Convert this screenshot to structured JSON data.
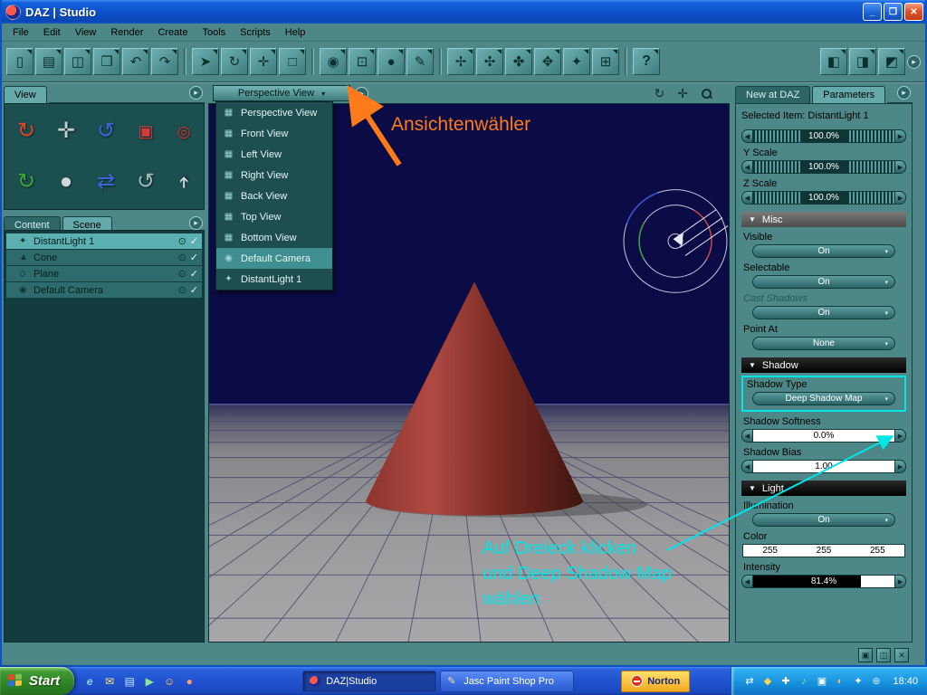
{
  "colors": {
    "accent_teal": "#4e8788",
    "panel_dark_teal": "#123c3d",
    "titlebar_blue": "#0d51c8",
    "taskbar_blue": "#2152cf",
    "annotation_orange": "#ff7a1a",
    "annotation_cyan": "#00e5e6",
    "highlight_box_cyan": "#00e5e6",
    "viewport_sky": "#0b0b46",
    "cone_red": "#a84038"
  },
  "glyphs": {
    "minimize": "_",
    "maximize": "❐",
    "close": "✕",
    "left_arrow": "◀",
    "right_arrow": "▶",
    "down_tri": "▾",
    "section_tri": "▼",
    "panel_arrow": "▸",
    "eye": "⊙",
    "check": "✓"
  },
  "titlebar": {
    "title": "DAZ | Studio"
  },
  "menubar": {
    "items": [
      "File",
      "Edit",
      "View",
      "Render",
      "Create",
      "Tools",
      "Scripts",
      "Help"
    ]
  },
  "toolbar": {
    "buttons": [
      {
        "name": "new-document",
        "glyph": "▯"
      },
      {
        "name": "open-file",
        "glyph": "▤"
      },
      {
        "name": "save-file",
        "glyph": "◫"
      },
      {
        "name": "copy",
        "glyph": "❐"
      },
      {
        "name": "undo",
        "glyph": "↶"
      },
      {
        "name": "redo",
        "glyph": "↷"
      },
      {
        "name": "select-tool",
        "glyph": "➤"
      },
      {
        "name": "rotate-tool",
        "glyph": "↻"
      },
      {
        "name": "translate-tool",
        "glyph": "✛"
      },
      {
        "name": "scale-tool",
        "glyph": "□"
      },
      {
        "name": "render",
        "glyph": "◉"
      },
      {
        "name": "spot-render",
        "glyph": "⊡"
      },
      {
        "name": "new-primitive",
        "glyph": "●"
      },
      {
        "name": "surface-selection",
        "glyph": "✎"
      },
      {
        "name": "create-null",
        "glyph": "✢"
      },
      {
        "name": "create-camera",
        "glyph": "✣"
      },
      {
        "name": "create-spotlight",
        "glyph": "✤"
      },
      {
        "name": "create-distant-light",
        "glyph": "✥"
      },
      {
        "name": "create-point-light",
        "glyph": "✦"
      },
      {
        "name": "frame-selection",
        "glyph": "⊞"
      },
      {
        "name": "help",
        "glyph": "?"
      }
    ],
    "right_buttons": [
      {
        "name": "layout-pane-left",
        "glyph": "◧"
      },
      {
        "name": "layout-pane-right",
        "glyph": "◨"
      },
      {
        "name": "layout-pane-split",
        "glyph": "◩"
      },
      {
        "name": "panel-expand",
        "glyph": "▸"
      }
    ]
  },
  "view_panel": {
    "tab": "View",
    "tools": [
      {
        "name": "orbit-camera",
        "glyph": "↻"
      },
      {
        "name": "pan-camera",
        "glyph": "✛"
      },
      {
        "name": "bank-camera",
        "glyph": "↺"
      },
      {
        "name": "frame-view",
        "glyph": "▣"
      },
      {
        "name": "aim-camera",
        "glyph": "◎"
      },
      {
        "name": "rotate-camera",
        "glyph": "↻"
      },
      {
        "name": "dolly-camera",
        "glyph": "●"
      },
      {
        "name": "zoom-camera",
        "glyph": "⇄"
      },
      {
        "name": "reset-camera",
        "glyph": "↺"
      },
      {
        "name": "camera-up",
        "glyph": "➔"
      }
    ]
  },
  "scene_panel": {
    "tabs": [
      "Content",
      "Scene"
    ],
    "items": [
      {
        "label": "DistantLight 1",
        "icon": "✦"
      },
      {
        "label": "Cone",
        "icon": "▲"
      },
      {
        "label": "Plane",
        "icon": "◇"
      },
      {
        "label": "Default Camera",
        "icon": "◉"
      }
    ]
  },
  "viewport": {
    "selector_label": "Perspective View",
    "menu": [
      {
        "label": "Perspective View",
        "icon": "▦"
      },
      {
        "label": "Front View",
        "icon": "▦"
      },
      {
        "label": "Left View",
        "icon": "▦"
      },
      {
        "label": "Right View",
        "icon": "▦"
      },
      {
        "label": "Back View",
        "icon": "▦"
      },
      {
        "label": "Top View",
        "icon": "▦"
      },
      {
        "label": "Bottom View",
        "icon": "▦"
      },
      {
        "label": "Default Camera",
        "icon": "◉"
      },
      {
        "label": "DistantLight 1",
        "icon": "✦"
      }
    ]
  },
  "annotations": {
    "orange_label": "Ansichtenwähler",
    "cyan_line1": "Auf Dreieck klicken",
    "cyan_line2": "und Deep Shadow Map",
    "cyan_line3": "wählen"
  },
  "params": {
    "tabs": [
      "New at DAZ",
      "Parameters"
    ],
    "selected_item": "Selected Item: DistantLight 1",
    "x_scale_value": "100.0%",
    "y_scale_label": "Y Scale",
    "y_scale_value": "100.0%",
    "z_scale_label": "Z Scale",
    "z_scale_value": "100.0%",
    "misc_header": "Misc",
    "visible_label": "Visible",
    "visible_value": "On",
    "selectable_label": "Selectable",
    "selectable_value": "On",
    "cast_shadows_label": "Cast Shadows",
    "cast_shadows_value": "On",
    "point_at_label": "Point At",
    "point_at_value": "None",
    "shadow_header": "Shadow",
    "shadow_type_label": "Shadow Type",
    "shadow_type_value": "Deep Shadow Map",
    "shadow_softness_label": "Shadow Softness",
    "shadow_softness_value": "0.0%",
    "shadow_bias_label": "Shadow Bias",
    "shadow_bias_value": "1.00",
    "light_header": "Light",
    "illumination_label": "Illumination",
    "illumination_value": "On",
    "color_label": "Color",
    "color_values": [
      "255",
      "255",
      "255"
    ],
    "intensity_label": "Intensity",
    "intensity_value": "81.4%"
  },
  "dock_buttons": [
    {
      "name": "dock-pin",
      "glyph": "▣"
    },
    {
      "name": "dock-float",
      "glyph": "◫"
    },
    {
      "name": "dock-close",
      "glyph": "✕"
    }
  ],
  "taskbar": {
    "start": "Start",
    "quick_launch": [
      {
        "name": "internet-explorer",
        "glyph": "e"
      },
      {
        "name": "email",
        "glyph": "✉"
      },
      {
        "name": "show-desktop",
        "glyph": "▤"
      },
      {
        "name": "media-player",
        "glyph": "▶"
      },
      {
        "name": "messenger",
        "glyph": "☺"
      },
      {
        "name": "browser",
        "glyph": "●"
      }
    ],
    "tasks": [
      {
        "label": "DAZ|Studio"
      },
      {
        "label": "Jasc Paint Shop Pro"
      }
    ],
    "norton": "Norton",
    "tray_icons": [
      {
        "name": "network",
        "glyph": "⇄"
      },
      {
        "name": "updates",
        "glyph": "◆"
      },
      {
        "name": "antivirus",
        "glyph": "✚"
      },
      {
        "name": "volume",
        "glyph": "♪"
      },
      {
        "name": "display",
        "glyph": "▣"
      },
      {
        "name": "scheduler",
        "glyph": "◐"
      },
      {
        "name": "graphics",
        "glyph": "✦"
      },
      {
        "name": "power",
        "glyph": "⊕"
      }
    ],
    "clock": "18:40"
  }
}
